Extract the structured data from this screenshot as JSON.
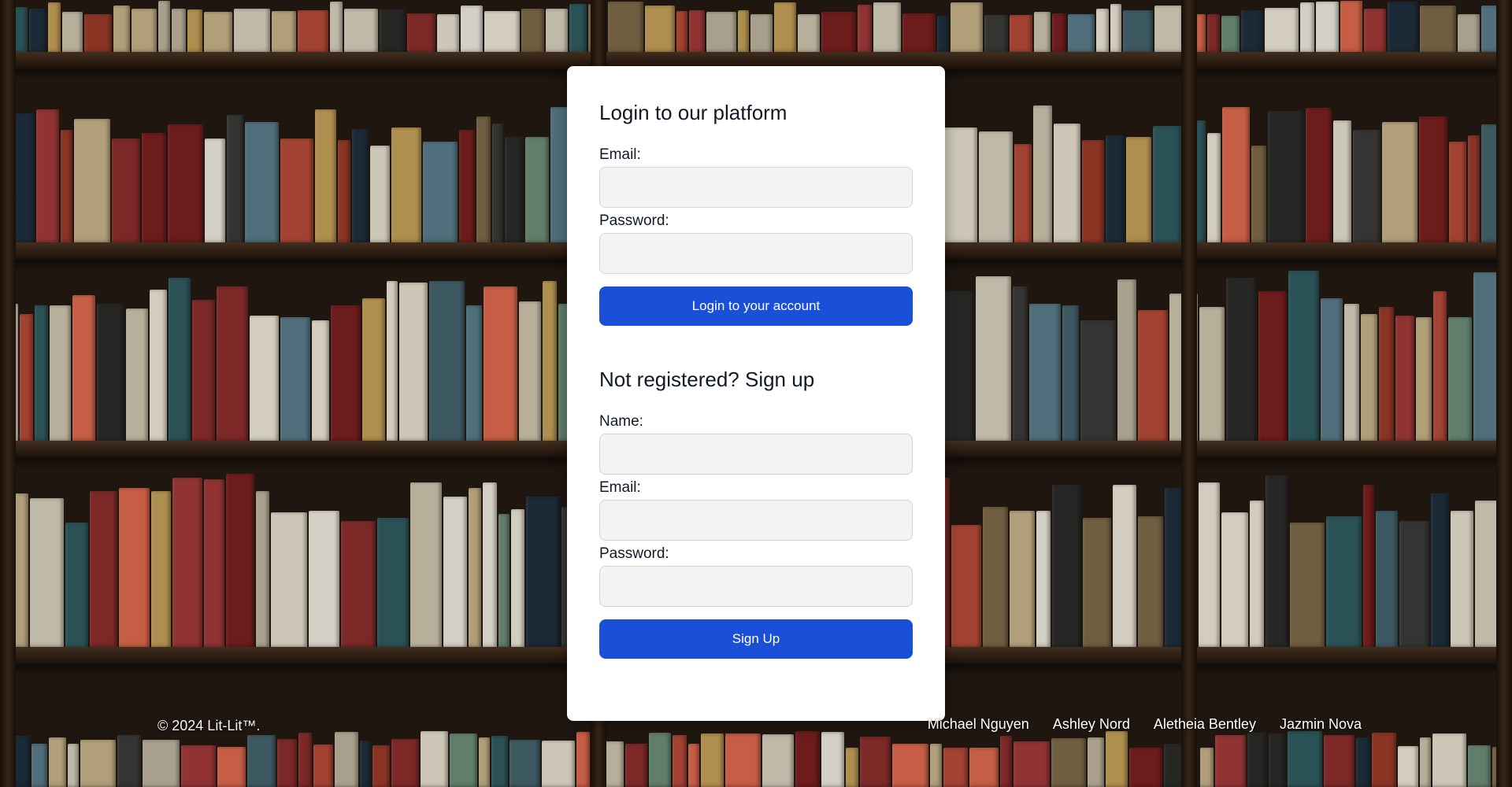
{
  "login": {
    "title": "Login to our platform",
    "email_label": "Email:",
    "email_value": "",
    "password_label": "Password:",
    "password_value": "",
    "submit_label": "Login to your account"
  },
  "signup": {
    "title": "Not registered? Sign up",
    "name_label": "Name:",
    "name_value": "",
    "email_label": "Email:",
    "email_value": "",
    "password_label": "Password:",
    "password_value": "",
    "submit_label": "Sign Up"
  },
  "footer": {
    "copyright": "© 2024 Lit-Lit™.",
    "links": [
      "Michael Nguyen",
      "Ashley Nord",
      "Aletheia Bentley",
      "Jazmin Nova"
    ]
  },
  "colors": {
    "primary_button": "#1a4fd8",
    "card_background": "#ffffff",
    "input_background": "#f3f4f6",
    "background_theme": "bookshelf-photo"
  }
}
